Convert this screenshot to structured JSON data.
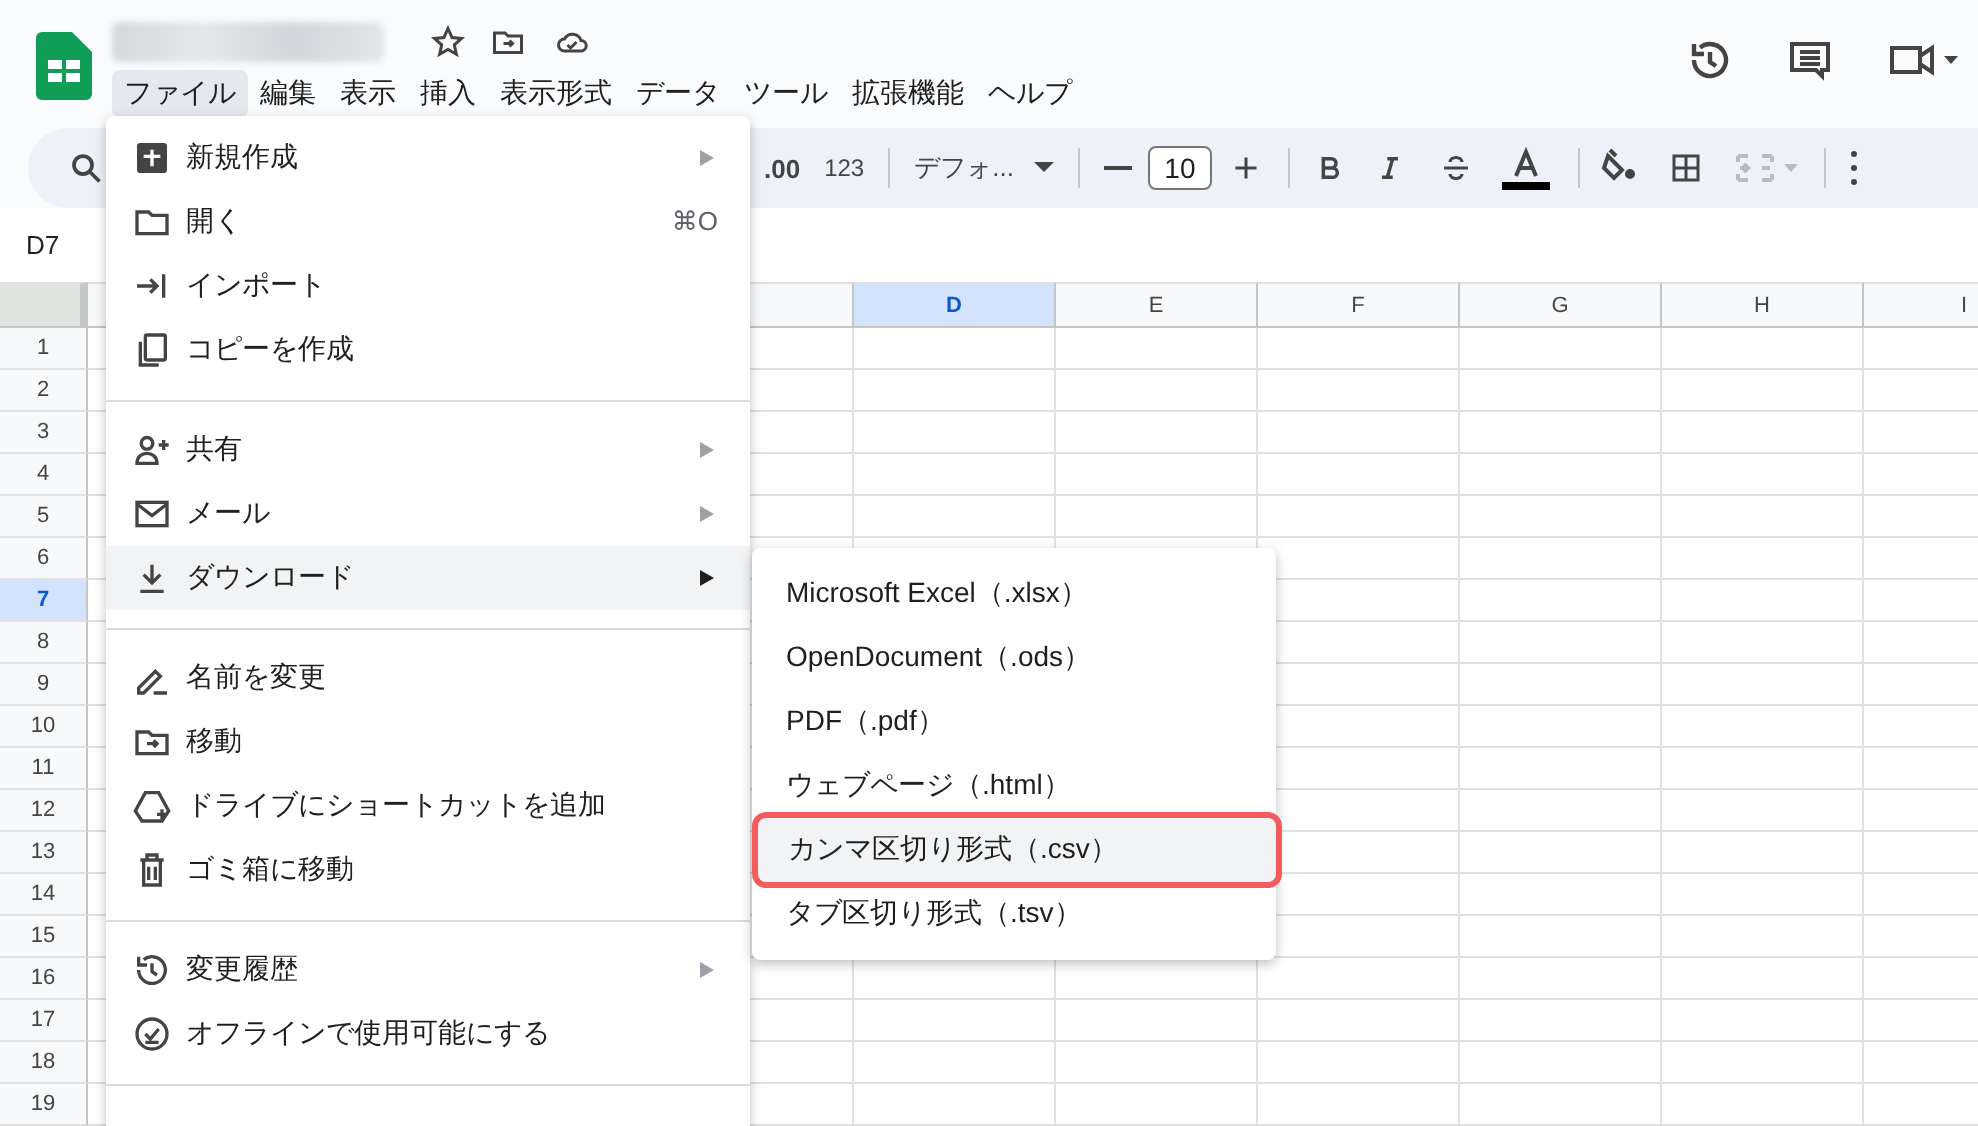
{
  "menubar": [
    {
      "label": "ファイル",
      "selected": true
    },
    {
      "label": "編集",
      "selected": false
    },
    {
      "label": "表示",
      "selected": false
    },
    {
      "label": "挿入",
      "selected": false
    },
    {
      "label": "表示形式",
      "selected": false
    },
    {
      "label": "データ",
      "selected": false
    },
    {
      "label": "ツール",
      "selected": false
    },
    {
      "label": "拡張機能",
      "selected": false
    },
    {
      "label": "ヘルプ",
      "selected": false
    }
  ],
  "toolbar": {
    "decimal": ".00",
    "number_format": "123",
    "font": "デフォ...",
    "font_size": "10"
  },
  "name_box": "D7",
  "columns": [
    {
      "label": "D",
      "selected": true
    },
    {
      "label": "E",
      "selected": false
    },
    {
      "label": "F",
      "selected": false
    },
    {
      "label": "G",
      "selected": false
    },
    {
      "label": "H",
      "selected": false
    },
    {
      "label": "I",
      "selected": false
    }
  ],
  "rows": [
    {
      "label": "1",
      "selected": false
    },
    {
      "label": "2",
      "selected": false
    },
    {
      "label": "3",
      "selected": false
    },
    {
      "label": "4",
      "selected": false
    },
    {
      "label": "5",
      "selected": false
    },
    {
      "label": "6",
      "selected": false
    },
    {
      "label": "7",
      "selected": true
    },
    {
      "label": "8",
      "selected": false
    },
    {
      "label": "9",
      "selected": false
    },
    {
      "label": "10",
      "selected": false
    },
    {
      "label": "11",
      "selected": false
    },
    {
      "label": "12",
      "selected": false
    },
    {
      "label": "13",
      "selected": false
    },
    {
      "label": "14",
      "selected": false
    },
    {
      "label": "15",
      "selected": false
    },
    {
      "label": "16",
      "selected": false
    },
    {
      "label": "17",
      "selected": false
    },
    {
      "label": "18",
      "selected": false
    },
    {
      "label": "19",
      "selected": false
    }
  ],
  "file_menu": [
    {
      "kind": "item",
      "label": "新規作成",
      "submenu": true,
      "highlighted": false
    },
    {
      "kind": "item",
      "label": "開く",
      "shortcut": "⌘O",
      "submenu": false,
      "highlighted": false
    },
    {
      "kind": "item",
      "label": "インポート",
      "submenu": false,
      "highlighted": false
    },
    {
      "kind": "item",
      "label": "コピーを作成",
      "submenu": false,
      "highlighted": false
    },
    {
      "kind": "divider"
    },
    {
      "kind": "item",
      "label": "共有",
      "submenu": true,
      "highlighted": false
    },
    {
      "kind": "item",
      "label": "メール",
      "submenu": true,
      "highlighted": false
    },
    {
      "kind": "item",
      "label": "ダウンロード",
      "submenu": true,
      "highlighted": true
    },
    {
      "kind": "divider"
    },
    {
      "kind": "item",
      "label": "名前を変更",
      "submenu": false,
      "highlighted": false
    },
    {
      "kind": "item",
      "label": "移動",
      "submenu": false,
      "highlighted": false
    },
    {
      "kind": "item",
      "label": "ドライブにショートカットを追加",
      "submenu": false,
      "highlighted": false
    },
    {
      "kind": "item",
      "label": "ゴミ箱に移動",
      "submenu": false,
      "highlighted": false
    },
    {
      "kind": "divider"
    },
    {
      "kind": "item",
      "label": "変更履歴",
      "submenu": true,
      "highlighted": false
    },
    {
      "kind": "item",
      "label": "オフラインで使用可能にする",
      "submenu": false,
      "highlighted": false
    },
    {
      "kind": "divider"
    }
  ],
  "download_menu": [
    {
      "label": "Microsoft Excel（.xlsx）",
      "highlighted": false,
      "outlined": false
    },
    {
      "label": "OpenDocument（.ods）",
      "highlighted": false,
      "outlined": false
    },
    {
      "label": "PDF（.pdf）",
      "highlighted": false,
      "outlined": false
    },
    {
      "label": "ウェブページ（.html）",
      "highlighted": false,
      "outlined": false
    },
    {
      "label": "カンマ区切り形式（.csv）",
      "highlighted": true,
      "outlined": true
    },
    {
      "label": "タブ区切り形式（.tsv）",
      "highlighted": false,
      "outlined": false
    }
  ]
}
